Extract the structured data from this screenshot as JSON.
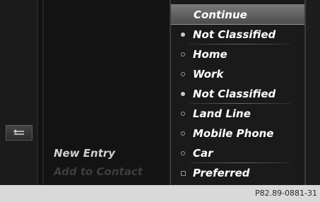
{
  "back_button": {
    "icon": "back-arrow-icon"
  },
  "left_menu": {
    "items": [
      {
        "label": "New Entry",
        "state": "selected"
      },
      {
        "label": "Add to Contact",
        "state": "disabled"
      }
    ]
  },
  "panel": {
    "continue_label": "Continue",
    "options": [
      {
        "label": "Not Classified",
        "marker": "filled-bullet"
      },
      {
        "label": "Home",
        "marker": "empty-bullet"
      },
      {
        "label": "Work",
        "marker": "empty-bullet"
      },
      {
        "label": "Not Classified",
        "marker": "filled-bullet"
      },
      {
        "label": "Land Line",
        "marker": "empty-bullet"
      },
      {
        "label": "Mobile Phone",
        "marker": "empty-bullet"
      },
      {
        "label": "Car",
        "marker": "empty-bullet"
      },
      {
        "label": "Preferred",
        "marker": "checkbox"
      }
    ]
  },
  "footer": {
    "reference": "P82.89-0881-31"
  }
}
